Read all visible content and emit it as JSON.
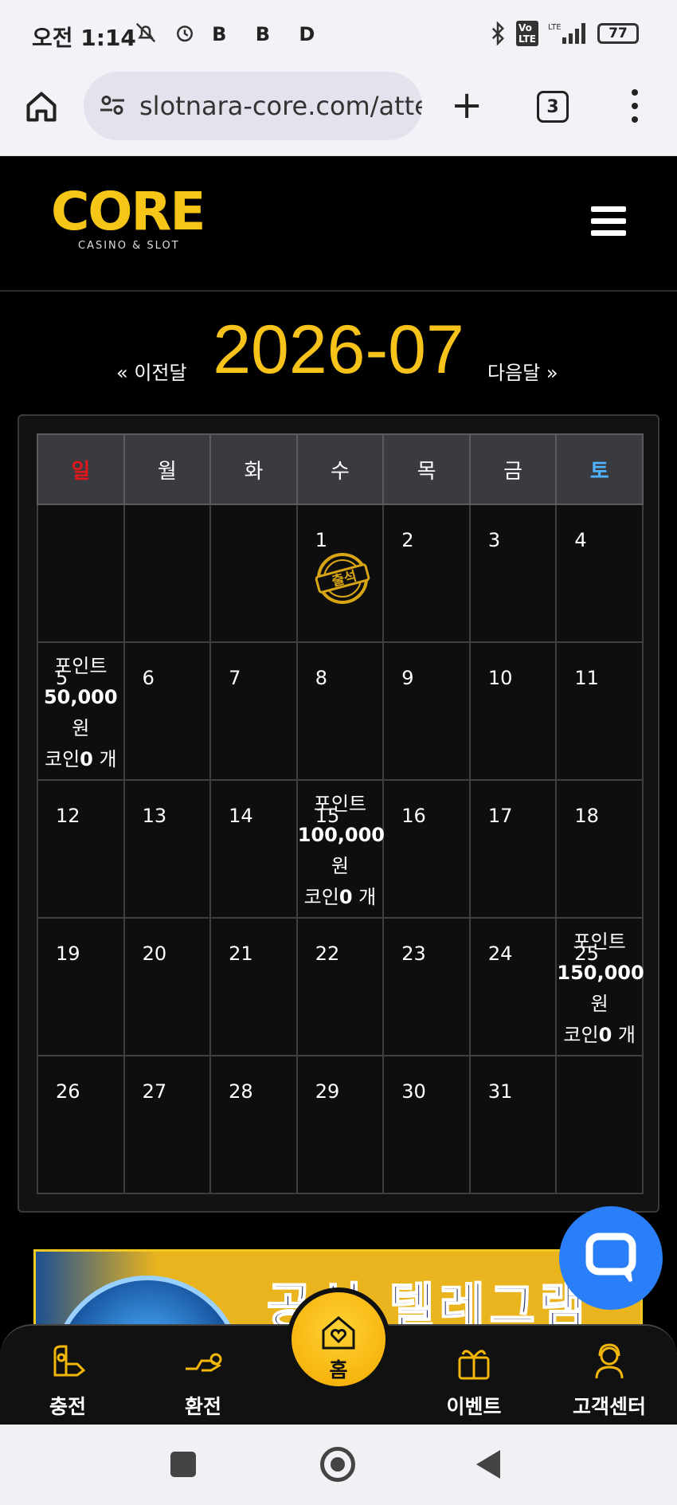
{
  "status_bar": {
    "time": "오전 1:14",
    "left_icons": [
      "mute-bell-icon",
      "alarm-icon",
      "b-app-icon",
      "b-app-icon",
      "d-app-icon"
    ],
    "left_icon_text": "B B D",
    "right_icons": [
      "bluetooth-icon",
      "volte-icon",
      "lte-signal-icon",
      "battery-icon"
    ],
    "battery": "77"
  },
  "browser": {
    "url": "slotnara-core.com/attendance",
    "tab_count": "3"
  },
  "site": {
    "logo_text": "CORE",
    "logo_subtitle": "CASINO & SLOT"
  },
  "calendar": {
    "title": "2026-07",
    "prev_label": "« 이전달",
    "next_label": "다음달 »",
    "weekdays": [
      "일",
      "월",
      "화",
      "수",
      "목",
      "금",
      "토"
    ],
    "weeks": [
      [
        {
          "day": ""
        },
        {
          "day": ""
        },
        {
          "day": ""
        },
        {
          "day": "1",
          "stamp": "출석"
        },
        {
          "day": "2"
        },
        {
          "day": "3"
        },
        {
          "day": "4"
        }
      ],
      [
        {
          "day": "5",
          "reward": {
            "line1": "포인트",
            "amount": "50,000",
            "unit": "원",
            "coin_label": "코인",
            "coin_count": "0",
            "coin_unit": " 개"
          }
        },
        {
          "day": "6"
        },
        {
          "day": "7"
        },
        {
          "day": "8"
        },
        {
          "day": "9"
        },
        {
          "day": "10"
        },
        {
          "day": "11"
        }
      ],
      [
        {
          "day": "12"
        },
        {
          "day": "13"
        },
        {
          "day": "14"
        },
        {
          "day": "15",
          "reward": {
            "line1": "포인트",
            "amount": "100,000",
            "unit": "원",
            "coin_label": "코인",
            "coin_count": "0",
            "coin_unit": " 개"
          }
        },
        {
          "day": "16"
        },
        {
          "day": "17"
        },
        {
          "day": "18"
        }
      ],
      [
        {
          "day": "19"
        },
        {
          "day": "20"
        },
        {
          "day": "21"
        },
        {
          "day": "22"
        },
        {
          "day": "23"
        },
        {
          "day": "24"
        },
        {
          "day": "25",
          "reward": {
            "line1": "포인트",
            "amount": "150,000",
            "unit": "원",
            "coin_label": "코인",
            "coin_count": "0",
            "coin_unit": " 개"
          }
        }
      ],
      [
        {
          "day": "26"
        },
        {
          "day": "27"
        },
        {
          "day": "28"
        },
        {
          "day": "29"
        },
        {
          "day": "30"
        },
        {
          "day": "31"
        },
        {
          "day": ""
        }
      ]
    ]
  },
  "banner": {
    "text": "공식 텔레그램"
  },
  "bottom_nav": {
    "items": [
      {
        "label": "충전",
        "icon": "deposit-icon"
      },
      {
        "label": "환전",
        "icon": "withdraw-icon"
      },
      {
        "label": "홈",
        "icon": "home-heart-icon"
      },
      {
        "label": "이벤트",
        "icon": "gift-icon"
      },
      {
        "label": "고객센터",
        "icon": "support-icon"
      }
    ]
  },
  "colors": {
    "accent_gold": "#f7c31b",
    "sunday_red": "#e0171b",
    "saturday_blue": "#4fb2ff",
    "chat_blue": "#2a7ef7"
  }
}
